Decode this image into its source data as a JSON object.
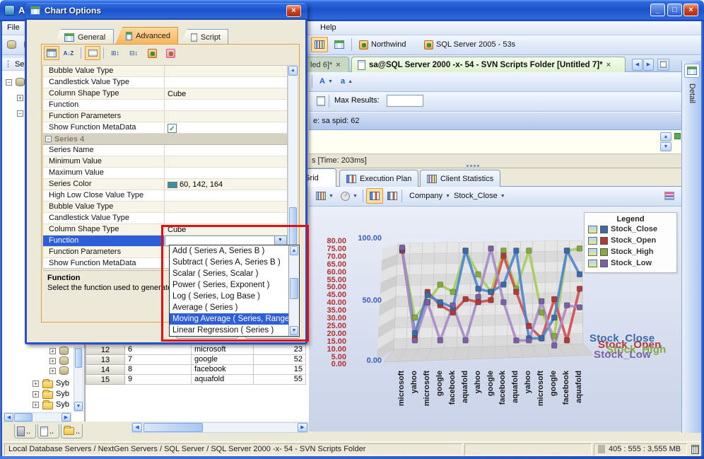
{
  "window": {
    "title_visible": "A"
  },
  "menu": {
    "file": "File",
    "help": "Help"
  },
  "main_toolbar": {
    "connections": [
      "Northwind",
      "SQL Server 2005 - 53s"
    ]
  },
  "doc_tabs": {
    "tabs": [
      {
        "label": "led 6]*",
        "active": false
      },
      {
        "label": "sa@SQL Server 2000 -x- 54 - SVN Scripts Folder [Untitled 7]*",
        "active": true
      }
    ]
  },
  "detail_panel": {
    "label": "Detail"
  },
  "query_toolbar": {
    "max_results_label": "Max Results:",
    "max_results_value": ""
  },
  "session_bar": {
    "text": "e:  sa     spid:  62"
  },
  "time_bar": {
    "text": "s [Time: 203ms]"
  },
  "result_tabs": {
    "tabs": [
      "Grid",
      "Execution Plan",
      "Client Statistics"
    ],
    "active": "Grid"
  },
  "chart_toolbar": {
    "category_field": "Company",
    "value_field": "Stock_Close"
  },
  "results_grid": {
    "rows": [
      [
        "12",
        "6",
        "microsoft",
        "23"
      ],
      [
        "13",
        "7",
        "google",
        "52"
      ],
      [
        "14",
        "8",
        "facebook",
        "15"
      ],
      [
        "15",
        "9",
        "aquafold",
        "55"
      ]
    ]
  },
  "server_tree": {
    "panel_header": "Ser",
    "folders": [
      "Syb",
      "Syb",
      "Syb"
    ],
    "bottom_tabs": [
      "..",
      "..",
      ".."
    ]
  },
  "status_bar": {
    "path": "Local Database Servers / NextGen Servers / SQL Server / SQL Server 2000 -x- 54 - SVN Scripts Folder",
    "memory": "405 : 555 : 3,555 MB"
  },
  "dialog": {
    "title": "Chart Options",
    "tabs": [
      "General",
      "Advanced",
      "Script"
    ],
    "active_tab": "Advanced",
    "properties": [
      {
        "name": "Bubble Value Type",
        "value": ""
      },
      {
        "name": "Candlestick Value Type",
        "value": ""
      },
      {
        "name": "Column Shape Type",
        "value": "Cube"
      },
      {
        "name": "Function",
        "value": ""
      },
      {
        "name": "Function Parameters",
        "value": ""
      },
      {
        "name": "Show Function MetaData",
        "value": "",
        "checked": true
      },
      {
        "name": "Series 4",
        "group": true
      },
      {
        "name": "Series Name",
        "value": ""
      },
      {
        "name": "Minimum Value",
        "value": ""
      },
      {
        "name": "Maximum Value",
        "value": ""
      },
      {
        "name": "Series Color",
        "value": "60, 142, 164",
        "swatch": "#3C8EA4"
      },
      {
        "name": "High Low Close Value Type",
        "value": ""
      },
      {
        "name": "Bubble Value Type",
        "value": ""
      },
      {
        "name": "Candlestick Value Type",
        "value": ""
      },
      {
        "name": "Column Shape Type",
        "value": "Cube"
      },
      {
        "name": "Function",
        "value": "",
        "selected": true,
        "combo": true
      },
      {
        "name": "Function Parameters",
        "value": ""
      },
      {
        "name": "Show Function MetaData",
        "value": ""
      }
    ],
    "description": {
      "title": "Function",
      "text": "Select the function used to generate"
    },
    "function_dropdown": {
      "items": [
        "Add ( Series A, Series B )",
        "Subtract ( Series A, Series B )",
        "Scalar ( Series, Scalar )",
        "Power ( Series, Exponent )",
        "Log ( Series, Log Base )",
        "Average ( Series )",
        "Moving Average ( Series, Range",
        "Linear Regression ( Series )"
      ],
      "selected_index": 6
    }
  },
  "chart_data": {
    "type": "line",
    "projection": "3d",
    "categories": [
      "microsoft",
      "yahoo",
      "microsoft",
      "google",
      "facebook",
      "aquafold",
      "yahoo",
      "google",
      "facebook",
      "aquafold",
      "yahoo",
      "microsoft",
      "google",
      "facebook",
      "aquafold"
    ],
    "series": [
      {
        "name": "Stock_Close",
        "line_color": "#4E86CF",
        "swatch_color": "#3A6AA8",
        "values": [
          97,
          15,
          52,
          45,
          40,
          95,
          58,
          55,
          62,
          95,
          10,
          10,
          30,
          95,
          72
        ]
      },
      {
        "name": "Stock_Open",
        "line_color": "#D05050",
        "swatch_color": "#B03A3A",
        "values": [
          95,
          10,
          55,
          42,
          35,
          48,
          45,
          47,
          90,
          55,
          22,
          10,
          48,
          8,
          58
        ]
      },
      {
        "name": "Stock_High",
        "line_color": "#A8CC60",
        "swatch_color": "#86A83E",
        "values": [
          95,
          30,
          45,
          62,
          55,
          95,
          72,
          55,
          95,
          58,
          95,
          35,
          12,
          95,
          97
        ]
      },
      {
        "name": "Stock_Low",
        "line_color": "#A78CC8",
        "swatch_color": "#7A5FA5",
        "values": [
          98,
          8,
          45,
          8,
          42,
          8,
          50,
          97,
          45,
          8,
          8,
          46,
          3,
          42,
          40
        ]
      }
    ],
    "left_axis": {
      "color": "#B03030",
      "min": 0,
      "max": 80,
      "step": 5,
      "labels": [
        "80.00",
        "75.00",
        "70.00",
        "65.00",
        "60.00",
        "55.00",
        "50.00",
        "45.00",
        "40.00",
        "35.00",
        "30.00",
        "25.00",
        "20.00",
        "15.00",
        "10.00",
        "5.00",
        "0.00"
      ]
    },
    "secondary_axis": {
      "color": "#3A5FC0",
      "min": 0,
      "max": 100,
      "step": 50,
      "labels": [
        "100.00",
        "50.00",
        "0.00"
      ]
    },
    "third_axis": {
      "color": "#3A9A3A",
      "labels": [
        "0.00"
      ]
    },
    "legend": {
      "title": "Legend",
      "position": "top-right"
    },
    "axis_label_overlays": [
      "Stock_Close",
      "Stock_Open",
      "Stock_High",
      "Stock_Low"
    ]
  }
}
